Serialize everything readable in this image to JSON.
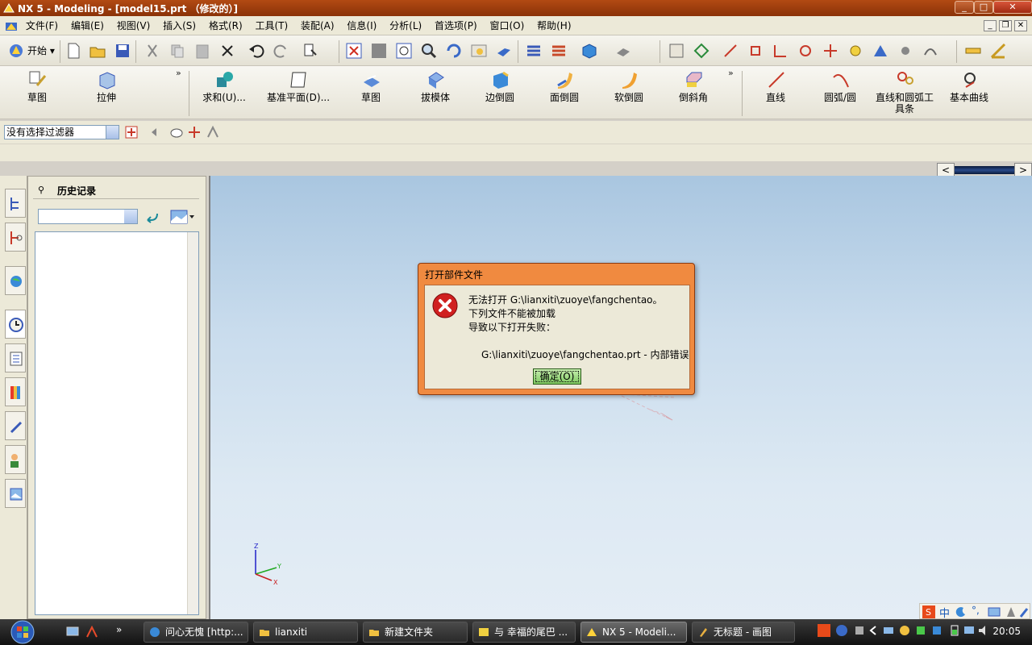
{
  "window": {
    "title": "NX 5 - Modeling - [model15.prt （修改的）]",
    "minimize": "_",
    "maximize": "□",
    "close": "✕"
  },
  "menubar": {
    "items": [
      "文件(F)",
      "编辑(E)",
      "视图(V)",
      "插入(S)",
      "格式(R)",
      "工具(T)",
      "装配(A)",
      "信息(I)",
      "分析(L)",
      "首选项(P)",
      "窗口(O)",
      "帮助(H)"
    ]
  },
  "toolbar": {
    "start_label": "开始"
  },
  "features": {
    "group1": [
      "草图",
      "拉伸"
    ],
    "group2": [
      "求和(U)...",
      "基准平面(D)...",
      "草图",
      "拔模体",
      "边倒圆",
      "面倒圆",
      "软倒圆",
      "倒斜角"
    ],
    "group3": [
      "直线",
      "圆弧/圆",
      "直线和圆弧工具条",
      "基本曲线"
    ],
    "overflow": "»"
  },
  "selection": {
    "filter_value": "没有选择过滤器"
  },
  "history": {
    "title": "历史记录",
    "pin": "⚲"
  },
  "dialog": {
    "title": "打开部件文件",
    "line1": "无法打开 G:\\lianxiti\\zuoye\\fangchentao。",
    "line2": "下列文件不能被加载",
    "line3": "导致以下打开失败：",
    "detail": "G:\\lianxiti\\zuoye\\fangchentao.prt - 内部错误",
    "ok_label": "确定(O)"
  },
  "triad": {
    "z": "Z",
    "y": "Y",
    "x": "X"
  },
  "scroll": {
    "left": "<",
    "right": ">"
  },
  "taskbar": {
    "tasks": [
      "问心无愧 [http:...",
      "lianxiti",
      "新建文件夹",
      "与 幸福的尾巴 ...",
      "NX 5 - Modeli...",
      "无标题 - 画图"
    ],
    "quicklaunch_more": "»",
    "clock": "20:05"
  },
  "ime": {
    "label": "S 中 ⟋ °, ▤ 🔧"
  },
  "colors": {
    "titlebar": "#b24a13",
    "dialog_frame": "#f08a40",
    "ok_button": "#7ec860",
    "error_icon": "#d02020"
  }
}
